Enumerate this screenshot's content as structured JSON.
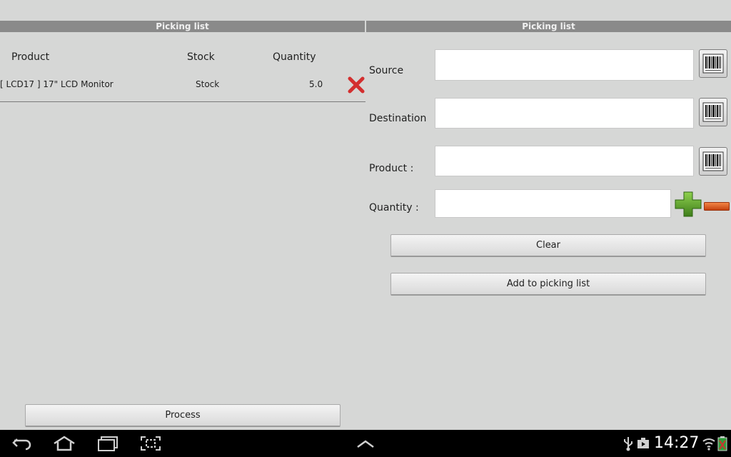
{
  "left_panel": {
    "title": "Picking list",
    "columns": {
      "product": "Product",
      "stock": "Stock",
      "quantity": "Quantity"
    },
    "rows": [
      {
        "product": "[ LCD17 ] 17\" LCD Monitor",
        "stock": "Stock",
        "quantity": "5.0"
      }
    ],
    "process_label": "Process"
  },
  "right_panel": {
    "title": "Picking list",
    "source_label": "Source",
    "destination_label": "Destination",
    "product_label": "Product :",
    "quantity_label": "Quantity :",
    "source_value": "",
    "destination_value": "",
    "product_value": "",
    "quantity_value": "",
    "clear_label": "Clear",
    "add_label": "Add to picking list"
  },
  "status_bar": {
    "time": "14:27"
  },
  "icons": {
    "delete": "x-delete-icon",
    "scan": "barcode-icon",
    "increase": "plus-icon",
    "decrease": "minus-icon"
  },
  "colors": {
    "background": "#d6d7d6",
    "title_bar": "#8a8a8a",
    "delete": "#d32f2f",
    "plus": "#5aa327",
    "minus": "#e25a1c"
  }
}
